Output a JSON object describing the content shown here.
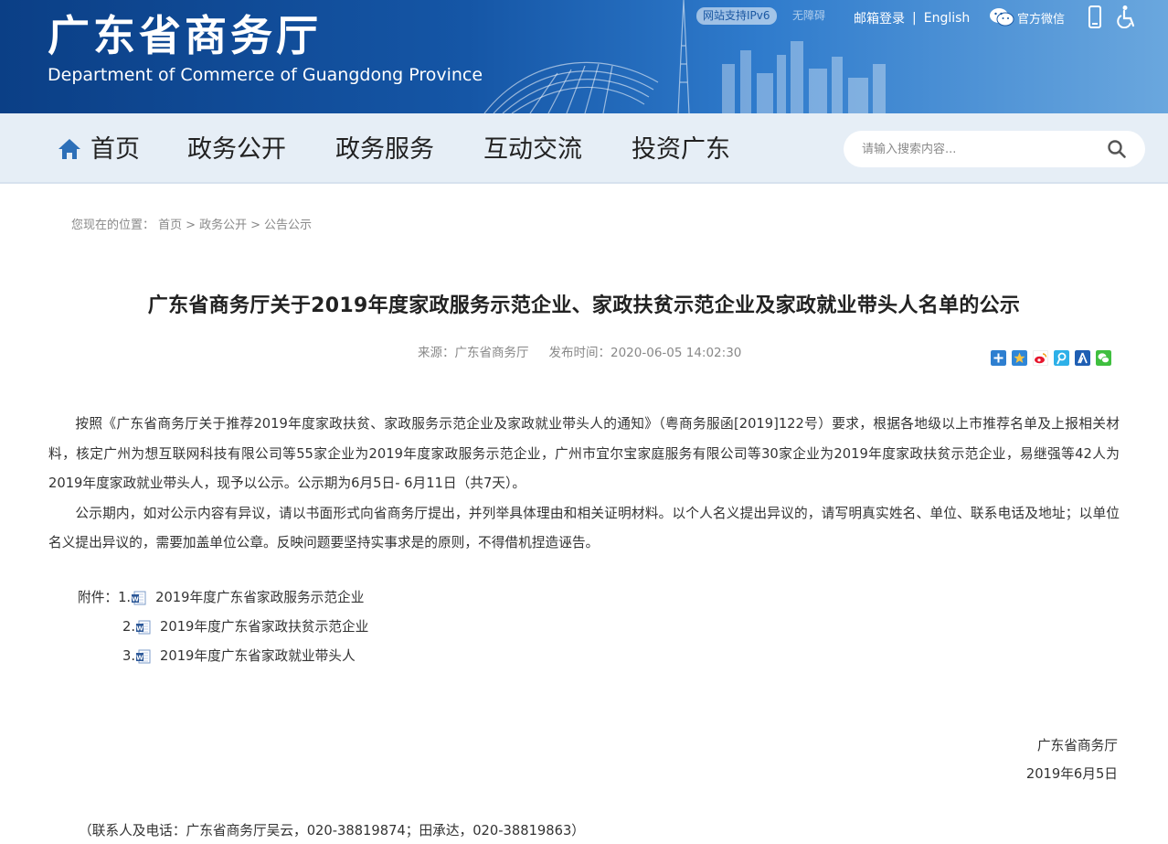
{
  "header": {
    "title": "广东省商务厅",
    "subtitle": "Department of Commerce of Guangdong Province",
    "ipv6_badge": "网站支持IPv6",
    "ipv6_side": "无障碍",
    "mail_login": "邮箱登录",
    "separator": "|",
    "english": "English",
    "wechat": "官方微信",
    "icons": [
      "wechat-icon",
      "mobile-icon",
      "accessibility-icon"
    ]
  },
  "nav": {
    "items": [
      "首页",
      "政务公开",
      "政务服务",
      "互动交流",
      "投资广东"
    ],
    "search_placeholder": "请输入搜索内容..."
  },
  "breadcrumb": {
    "prefix": "您现在的位置：",
    "items": [
      "首页",
      "政务公开",
      "公告公示"
    ],
    "separator": ">"
  },
  "article": {
    "title": "广东省商务厅关于2019年度家政服务示范企业、家政扶贫示范企业及家政就业带头人名单的公示",
    "source": "来源：广东省商务厅",
    "published": "发布时间：2020-06-05 14:02:30",
    "paragraphs": [
      "按照《广东省商务厅关于推荐2019年度家政扶贫、家政服务示范企业及家政就业带头人的通知》（粤商务服函[2019]122号）要求，根据各地级以上市推荐名单及上报相关材料，核定广州为想互联网科技有限公司等55家企业为2019年度家政服务示范企业，广州市宜尔宝家庭服务有限公司等30家企业为2019年度家政扶贫示范企业，易继强等42人为2019年度家政就业带头人，现予以公示。公示期为6月5日- 6月11日（共7天）。",
      "公示期内，如对公示内容有异议，请以书面形式向省商务厅提出，并列举具体理由和相关证明材料。以个人名义提出异议的，请写明真实姓名、单位、联系电话及地址；以单位名义提出异议的，需要加盖单位公章。反映问题要坚持实事求是的原则，不得借机捏造诬告。"
    ],
    "attachments_label": "附件：",
    "attachments": [
      {
        "num": "1.",
        "name": "2019年度广东省家政服务示范企业"
      },
      {
        "num": "2.",
        "name": "2019年度广东省家政扶贫示范企业"
      },
      {
        "num": "3.",
        "name": "2019年度广东省家政就业带头人"
      }
    ],
    "signature_org": "广东省商务厅",
    "signature_date": "2019年6月5日",
    "contact": "（联系人及电话：广东省商务厅吴云，020-38819874；田承达，020-38819863）"
  },
  "share_icons": [
    "share-more-icon",
    "qzone-icon",
    "weibo-icon",
    "tencent-weibo-icon",
    "renren-icon",
    "wechat-share-icon"
  ],
  "colors": {
    "banner": "#1556a6",
    "nav_bg": "#e6eef6",
    "accent": "#1b58a3"
  }
}
